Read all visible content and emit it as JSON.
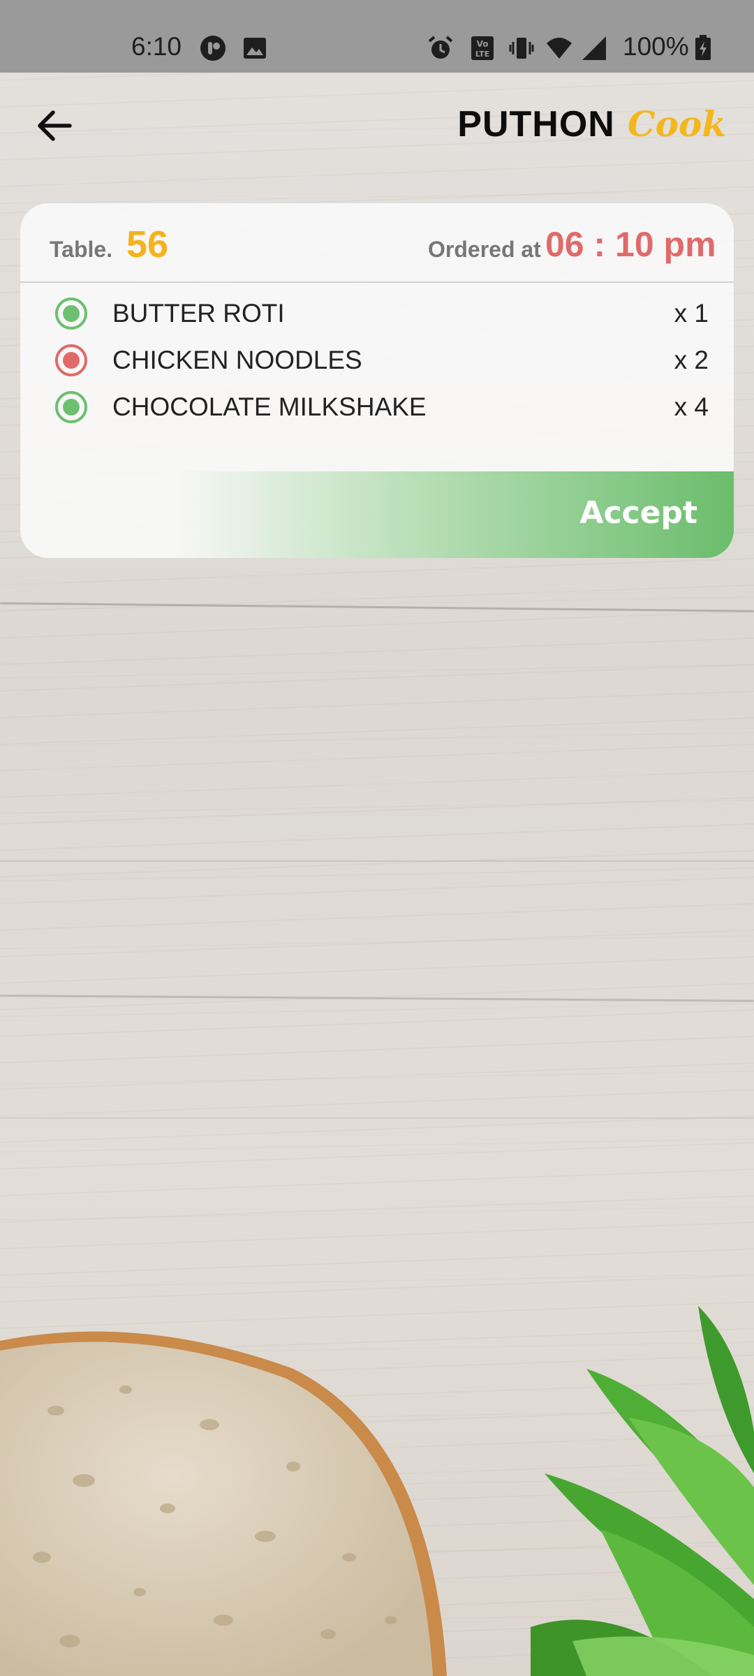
{
  "status_bar": {
    "time": "6:10",
    "battery": "100%",
    "icons": [
      "app-notification-icon",
      "image-icon",
      "alarm-icon",
      "volte-icon",
      "vibrate-icon",
      "wifi-icon",
      "signal-icon",
      "battery-charging-icon"
    ]
  },
  "app_bar": {
    "back_icon": "arrow-left-icon",
    "brand_main": "PUTHON",
    "brand_accent": "Cook"
  },
  "order": {
    "table_label": "Table.",
    "table_number": "56",
    "ordered_label": "Ordered at",
    "ordered_time": "06 : 10 pm",
    "items": [
      {
        "name": "BUTTER ROTI",
        "qty": "x 1",
        "status": "green"
      },
      {
        "name": "CHICKEN NOODLES",
        "qty": "x 2",
        "status": "red"
      },
      {
        "name": "CHOCOLATE MILKSHAKE",
        "qty": "x 4",
        "status": "green"
      }
    ],
    "accept_label": "Accept"
  },
  "colors": {
    "accent_yellow": "#f5b21b",
    "time_red": "#e06a6a",
    "veg_green": "#6cc070",
    "nonveg_red": "#e06a6a",
    "accept_green": "#6bbd6c"
  }
}
